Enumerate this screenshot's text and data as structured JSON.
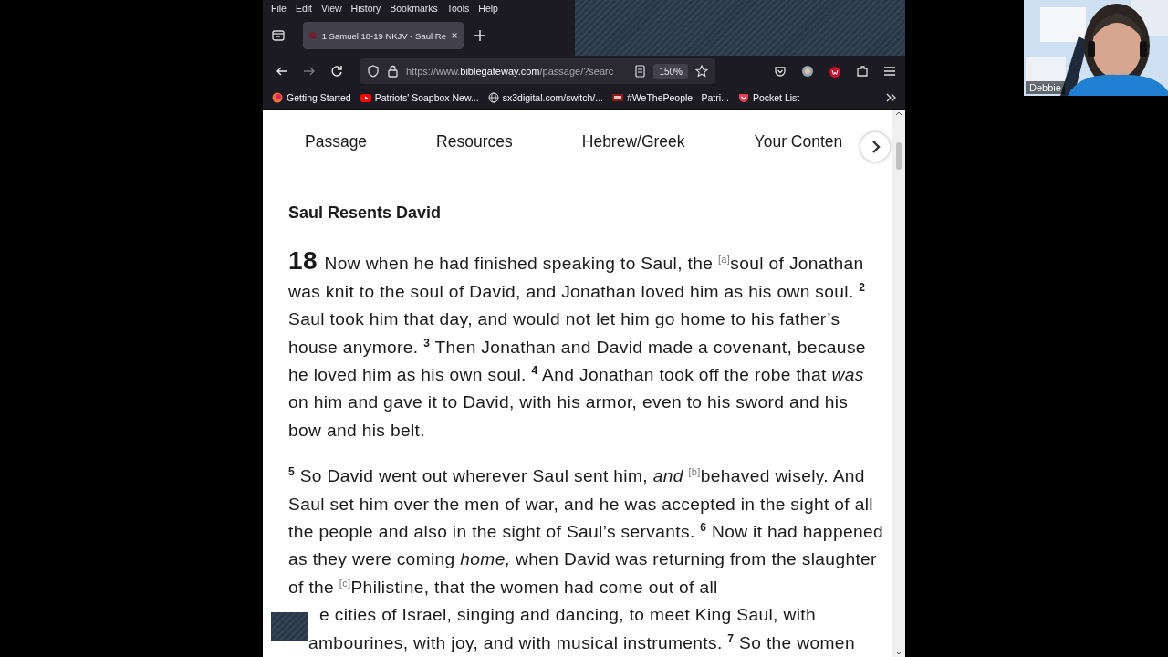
{
  "menu": [
    "File",
    "Edit",
    "View",
    "History",
    "Bookmarks",
    "Tools",
    "Help"
  ],
  "tabs": [
    {
      "title": "1 Samuel 18-19 NKJV - Saul Re",
      "selected": true
    }
  ],
  "address": {
    "prefix": "https://www.",
    "domain": "biblegateway.com",
    "path": "/passage/?searc"
  },
  "zoom": "150%",
  "bookmarks": [
    {
      "label": "Getting Started",
      "kind": "firefox"
    },
    {
      "label": "Patriots' Soapbox New...",
      "kind": "video"
    },
    {
      "label": "sx3digital.com/switch/...",
      "kind": "globe"
    },
    {
      "label": "#WeThePeople - Patri...",
      "kind": "badge"
    },
    {
      "label": "Pocket List",
      "kind": "pocket"
    }
  ],
  "page_tabs": [
    "Passage",
    "Resources",
    "Hebrew/Greek",
    "Your Conten"
  ],
  "heading": "Saul Resents David",
  "paragraphs": [
    [
      {
        "kind": "chapter",
        "text": "18"
      },
      {
        "kind": "text",
        "text": " Now when he had finished speaking to Saul, the "
      },
      {
        "kind": "footnote",
        "text": "[a]"
      },
      {
        "kind": "text",
        "text": "soul of Jonathan was knit to the soul of David, and Jonathan loved him as his own soul. "
      },
      {
        "kind": "verse",
        "text": "2"
      },
      {
        "kind": "text",
        "text": " Saul took him that day, and would not let him go home to his father’s house anymore. "
      },
      {
        "kind": "verse",
        "text": "3"
      },
      {
        "kind": "text",
        "text": " Then Jonathan and David made a covenant, because he loved him as his own soul. "
      },
      {
        "kind": "verse",
        "text": "4"
      },
      {
        "kind": "text",
        "text": " And Jonathan took off the robe that "
      },
      {
        "kind": "italic",
        "text": "was"
      },
      {
        "kind": "text",
        "text": " on him and gave it to David, with his armor, even to his sword and his bow and his belt."
      }
    ],
    [
      {
        "kind": "verse",
        "text": "5"
      },
      {
        "kind": "text",
        "text": " So David went out wherever Saul sent him, "
      },
      {
        "kind": "italic",
        "text": "and "
      },
      {
        "kind": "footnote",
        "text": "[b]"
      },
      {
        "kind": "text",
        "text": "behaved wisely. And Saul set him over the men of war, and he was accepted in the sight of all the people and also in the sight of Saul’s servants. "
      },
      {
        "kind": "verse",
        "text": "6"
      },
      {
        "kind": "text",
        "text": " Now it had happened as they were coming "
      },
      {
        "kind": "italic",
        "text": "home,"
      },
      {
        "kind": "text",
        "text": " when David was returning from the slaughter of the "
      },
      {
        "kind": "footnote",
        "text": "[c]"
      },
      {
        "kind": "text",
        "text": "Philistine, that the women had come out of all"
      }
    ]
  ],
  "covered_lines": [
    [
      {
        "kind": "text",
        "text": "e cities of Israel, singing and dancing, to meet King Saul, with"
      }
    ],
    [
      {
        "kind": "text",
        "text": "ambourines, with joy, and with musical instruments. "
      },
      {
        "kind": "verse",
        "text": "7"
      },
      {
        "kind": "text",
        "text": " So the women"
      }
    ]
  ],
  "webcam": {
    "name": "Debbie"
  }
}
